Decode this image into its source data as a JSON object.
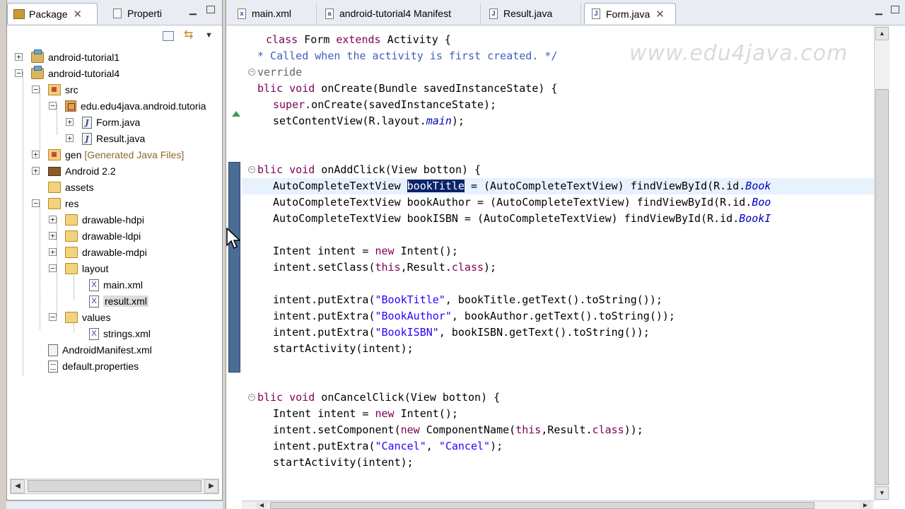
{
  "package_explorer": {
    "tab_label": "Package",
    "properties_tab_label": "Properti",
    "tree": [
      {
        "label": "android-tutorial1",
        "toggle": "+"
      },
      {
        "label": "android-tutorial4",
        "toggle": "−"
      },
      {
        "label": "src",
        "toggle": "−"
      },
      {
        "label": "edu.edu4java.android.tutoria",
        "toggle": "−"
      },
      {
        "label": "Form.java",
        "toggle": "+"
      },
      {
        "label": "Result.java",
        "toggle": "+"
      },
      {
        "label": "gen",
        "decoration": "[Generated Java Files]",
        "toggle": "+"
      },
      {
        "label": "Android 2.2",
        "toggle": "+"
      },
      {
        "label": "assets"
      },
      {
        "label": "res",
        "toggle": "−"
      },
      {
        "label": "drawable-hdpi",
        "toggle": "+"
      },
      {
        "label": "drawable-ldpi",
        "toggle": "+"
      },
      {
        "label": "drawable-mdpi",
        "toggle": "+"
      },
      {
        "label": "layout",
        "toggle": "−"
      },
      {
        "label": "main.xml"
      },
      {
        "label": "result.xml"
      },
      {
        "label": "values",
        "toggle": "−"
      },
      {
        "label": "strings.xml"
      },
      {
        "label": "AndroidManifest.xml"
      },
      {
        "label": "default.properties"
      }
    ]
  },
  "editor": {
    "tabs": [
      {
        "label": "main.xml",
        "icon": "x"
      },
      {
        "label": "android-tutorial4 Manifest",
        "icon": "a"
      },
      {
        "label": "Result.java",
        "icon": "J"
      },
      {
        "label": "Form.java",
        "icon": "J"
      }
    ],
    "watermark": "www.edu4java.com",
    "code": {
      "l1_kw1": "class",
      "l1_txt1": " Form ",
      "l1_kw2": "extends",
      "l1_txt2": " Activity {",
      "l2": "* Called when the activity is first created. */",
      "l3": "verride",
      "l4_kw": "blic void",
      "l4_txt": " onCreate(Bundle savedInstanceState) {",
      "l5_kw": "super",
      "l5_txt": ".onCreate(savedInstanceState);",
      "l6_txt1": "setContentView(R.layout.",
      "l6_it": "main",
      "l6_txt2": ");",
      "l8_kw": "blic void",
      "l8_txt": " onAddClick(View botton) {",
      "l9_txt1": "AutoCompleteTextView ",
      "l9_sel": "bookTitle",
      "l9_txt2": " = (AutoCompleteTextView) findViewById(R.id.",
      "l9_it": "Book",
      "l10_txt1": "AutoCompleteTextView bookAuthor = (AutoCompleteTextView) findViewById(R.id.",
      "l10_it": "Boo",
      "l11_txt1": "AutoCompleteTextView bookISBN = (AutoCompleteTextView) findViewById(R.id.",
      "l11_it": "BookI",
      "l13_txt1": "Intent intent = ",
      "l13_kw": "new",
      "l13_txt2": " Intent();",
      "l14_txt1": "intent.setClass(",
      "l14_kw1": "this",
      "l14_txt2": ",Result.",
      "l14_kw2": "class",
      "l14_txt3": ");",
      "l16_txt1": "intent.putExtra(",
      "l16_str": "\"BookTitle\"",
      "l16_txt2": ", bookTitle.getText().toString());",
      "l17_txt1": "intent.putExtra(",
      "l17_str": "\"BookAuthor\"",
      "l17_txt2": ", bookAuthor.getText().toString());",
      "l18_txt1": "intent.putExtra(",
      "l18_str": "\"BookISBN\"",
      "l18_txt2": ", bookISBN.getText().toString());",
      "l19": "startActivity(intent);",
      "l22_kw": "blic void",
      "l22_txt": " onCancelClick(View botton) {",
      "l23_txt1": "Intent intent = ",
      "l23_kw": "new",
      "l23_txt2": " Intent();",
      "l24_txt1": "intent.setComponent(",
      "l24_kw1": "new",
      "l24_txt2": " ComponentName(",
      "l24_kw2": "this",
      "l24_txt3": ",Result.",
      "l24_kw3": "class",
      "l24_txt4": "));",
      "l25_txt1": "intent.putExtra(",
      "l25_str1": "\"Cancel\"",
      "l25_txt2": ", ",
      "l25_str2": "\"Cancel\"",
      "l25_txt3": ");",
      "l26": "startActivity(intent);"
    }
  },
  "colors": {
    "keyword": "#7f0055",
    "comment": "#3f5fbf",
    "string": "#2a00ff",
    "selection": "#0a246a",
    "field_italic": "#0000c0"
  }
}
